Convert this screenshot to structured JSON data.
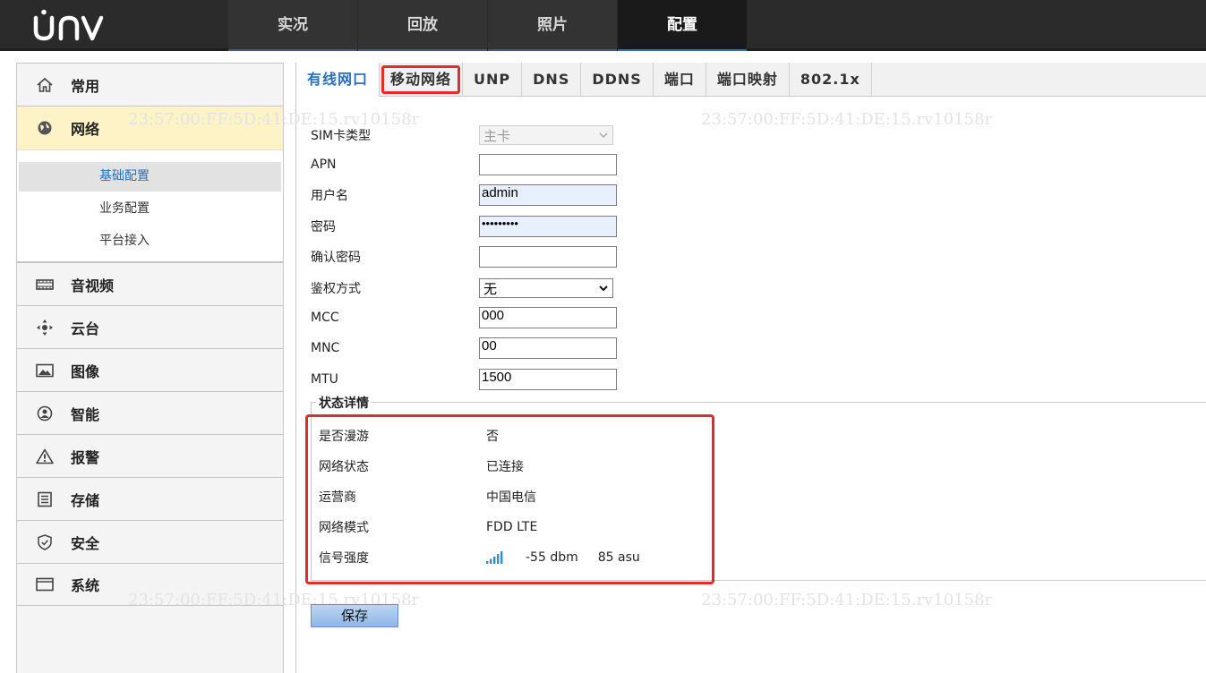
{
  "brand": {
    "logo_text": "UNV"
  },
  "top_nav": [
    {
      "label": "实况",
      "active": false
    },
    {
      "label": "回放",
      "active": false
    },
    {
      "label": "照片",
      "active": false
    },
    {
      "label": "配置",
      "active": true
    }
  ],
  "sidebar": {
    "items": [
      {
        "label": "常用",
        "icon": "home-icon"
      },
      {
        "label": "网络",
        "icon": "globe-icon",
        "active": true
      },
      {
        "label": "音视频",
        "icon": "video-icon"
      },
      {
        "label": "云台",
        "icon": "ptz-icon"
      },
      {
        "label": "图像",
        "icon": "image-icon"
      },
      {
        "label": "智能",
        "icon": "smart-icon"
      },
      {
        "label": "报警",
        "icon": "alarm-icon"
      },
      {
        "label": "存储",
        "icon": "storage-icon"
      },
      {
        "label": "安全",
        "icon": "shield-icon"
      },
      {
        "label": "系统",
        "icon": "system-icon"
      }
    ],
    "network_submenu": [
      {
        "label": "基础配置",
        "active": true
      },
      {
        "label": "业务配置"
      },
      {
        "label": "平台接入"
      }
    ]
  },
  "tabs": [
    {
      "label": "有线网口",
      "current": true
    },
    {
      "label": "移动网络",
      "highlighted": true
    },
    {
      "label": "UNP"
    },
    {
      "label": "DNS"
    },
    {
      "label": "DDNS"
    },
    {
      "label": "端口"
    },
    {
      "label": "端口映射"
    },
    {
      "label": "802.1x"
    }
  ],
  "watermark": "23:57:00:FF:5D:41:DE:15.rv10158r",
  "form": {
    "sim_type": {
      "label": "SIM卡类型",
      "value": "主卡",
      "disabled": true
    },
    "apn": {
      "label": "APN",
      "value": ""
    },
    "username": {
      "label": "用户名",
      "value": "admin"
    },
    "password": {
      "label": "密码",
      "value": "•••••••••"
    },
    "confirm_password": {
      "label": "确认密码",
      "value": ""
    },
    "auth_method": {
      "label": "鉴权方式",
      "value": "无"
    },
    "mcc": {
      "label": "MCC",
      "value": "000"
    },
    "mnc": {
      "label": "MNC",
      "value": "00"
    },
    "mtu": {
      "label": "MTU",
      "value": "1500"
    }
  },
  "status": {
    "legend": "状态详情",
    "roaming": {
      "label": "是否漫游",
      "value": "否"
    },
    "network_state": {
      "label": "网络状态",
      "value": "已连接"
    },
    "carrier": {
      "label": "运营商",
      "value": "中国电信"
    },
    "network_mode": {
      "label": "网络模式",
      "value": "FDD LTE"
    },
    "signal": {
      "label": "信号强度",
      "dbm": "-55 dbm",
      "asu": "85 asu",
      "bars": 5
    }
  },
  "save_label": "保存",
  "colors": {
    "accent_blue": "#2c6fbd",
    "highlight_red": "#e42b2b",
    "active_menu_bg": "#fdf3c7",
    "topbar": "#2b2b2b"
  }
}
